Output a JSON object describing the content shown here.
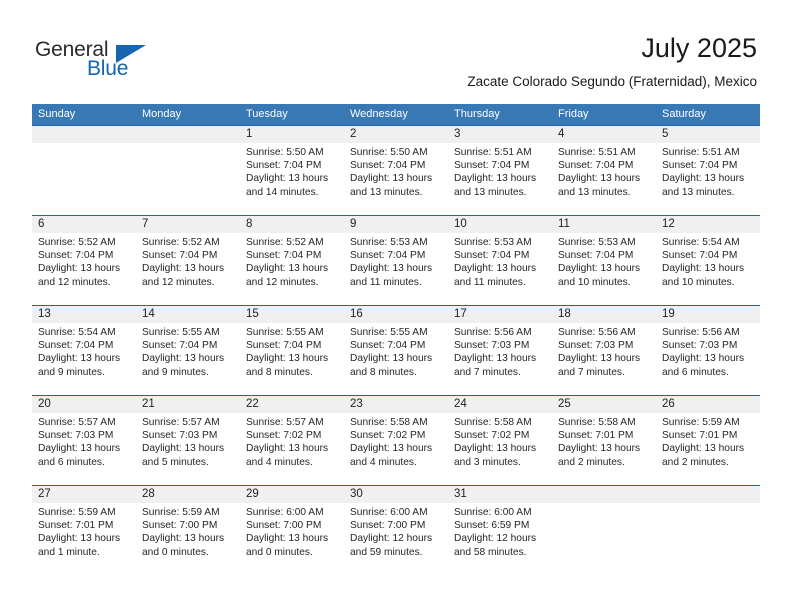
{
  "brand": {
    "name_part1": "General",
    "name_part2": "Blue"
  },
  "header": {
    "month_title": "July 2025",
    "location": "Zacate Colorado Segundo (Fraternidad), Mexico"
  },
  "theme": {
    "header_blue": "#3878b4",
    "row_border_blue": "#1f63a8",
    "day_band_gray": "#f0f0f0",
    "brand_blue": "#1565b0"
  },
  "weekdays": [
    "Sunday",
    "Monday",
    "Tuesday",
    "Wednesday",
    "Thursday",
    "Friday",
    "Saturday"
  ],
  "weeks": [
    [
      {
        "day": "",
        "sunrise": "",
        "sunset": "",
        "daylight": ""
      },
      {
        "day": "",
        "sunrise": "",
        "sunset": "",
        "daylight": ""
      },
      {
        "day": "1",
        "sunrise": "Sunrise: 5:50 AM",
        "sunset": "Sunset: 7:04 PM",
        "daylight": "Daylight: 13 hours and 14 minutes."
      },
      {
        "day": "2",
        "sunrise": "Sunrise: 5:50 AM",
        "sunset": "Sunset: 7:04 PM",
        "daylight": "Daylight: 13 hours and 13 minutes."
      },
      {
        "day": "3",
        "sunrise": "Sunrise: 5:51 AM",
        "sunset": "Sunset: 7:04 PM",
        "daylight": "Daylight: 13 hours and 13 minutes."
      },
      {
        "day": "4",
        "sunrise": "Sunrise: 5:51 AM",
        "sunset": "Sunset: 7:04 PM",
        "daylight": "Daylight: 13 hours and 13 minutes."
      },
      {
        "day": "5",
        "sunrise": "Sunrise: 5:51 AM",
        "sunset": "Sunset: 7:04 PM",
        "daylight": "Daylight: 13 hours and 13 minutes."
      }
    ],
    [
      {
        "day": "6",
        "sunrise": "Sunrise: 5:52 AM",
        "sunset": "Sunset: 7:04 PM",
        "daylight": "Daylight: 13 hours and 12 minutes."
      },
      {
        "day": "7",
        "sunrise": "Sunrise: 5:52 AM",
        "sunset": "Sunset: 7:04 PM",
        "daylight": "Daylight: 13 hours and 12 minutes."
      },
      {
        "day": "8",
        "sunrise": "Sunrise: 5:52 AM",
        "sunset": "Sunset: 7:04 PM",
        "daylight": "Daylight: 13 hours and 12 minutes."
      },
      {
        "day": "9",
        "sunrise": "Sunrise: 5:53 AM",
        "sunset": "Sunset: 7:04 PM",
        "daylight": "Daylight: 13 hours and 11 minutes."
      },
      {
        "day": "10",
        "sunrise": "Sunrise: 5:53 AM",
        "sunset": "Sunset: 7:04 PM",
        "daylight": "Daylight: 13 hours and 11 minutes."
      },
      {
        "day": "11",
        "sunrise": "Sunrise: 5:53 AM",
        "sunset": "Sunset: 7:04 PM",
        "daylight": "Daylight: 13 hours and 10 minutes."
      },
      {
        "day": "12",
        "sunrise": "Sunrise: 5:54 AM",
        "sunset": "Sunset: 7:04 PM",
        "daylight": "Daylight: 13 hours and 10 minutes."
      }
    ],
    [
      {
        "day": "13",
        "sunrise": "Sunrise: 5:54 AM",
        "sunset": "Sunset: 7:04 PM",
        "daylight": "Daylight: 13 hours and 9 minutes."
      },
      {
        "day": "14",
        "sunrise": "Sunrise: 5:55 AM",
        "sunset": "Sunset: 7:04 PM",
        "daylight": "Daylight: 13 hours and 9 minutes."
      },
      {
        "day": "15",
        "sunrise": "Sunrise: 5:55 AM",
        "sunset": "Sunset: 7:04 PM",
        "daylight": "Daylight: 13 hours and 8 minutes."
      },
      {
        "day": "16",
        "sunrise": "Sunrise: 5:55 AM",
        "sunset": "Sunset: 7:04 PM",
        "daylight": "Daylight: 13 hours and 8 minutes."
      },
      {
        "day": "17",
        "sunrise": "Sunrise: 5:56 AM",
        "sunset": "Sunset: 7:03 PM",
        "daylight": "Daylight: 13 hours and 7 minutes."
      },
      {
        "day": "18",
        "sunrise": "Sunrise: 5:56 AM",
        "sunset": "Sunset: 7:03 PM",
        "daylight": "Daylight: 13 hours and 7 minutes."
      },
      {
        "day": "19",
        "sunrise": "Sunrise: 5:56 AM",
        "sunset": "Sunset: 7:03 PM",
        "daylight": "Daylight: 13 hours and 6 minutes."
      }
    ],
    [
      {
        "day": "20",
        "sunrise": "Sunrise: 5:57 AM",
        "sunset": "Sunset: 7:03 PM",
        "daylight": "Daylight: 13 hours and 6 minutes."
      },
      {
        "day": "21",
        "sunrise": "Sunrise: 5:57 AM",
        "sunset": "Sunset: 7:03 PM",
        "daylight": "Daylight: 13 hours and 5 minutes."
      },
      {
        "day": "22",
        "sunrise": "Sunrise: 5:57 AM",
        "sunset": "Sunset: 7:02 PM",
        "daylight": "Daylight: 13 hours and 4 minutes."
      },
      {
        "day": "23",
        "sunrise": "Sunrise: 5:58 AM",
        "sunset": "Sunset: 7:02 PM",
        "daylight": "Daylight: 13 hours and 4 minutes."
      },
      {
        "day": "24",
        "sunrise": "Sunrise: 5:58 AM",
        "sunset": "Sunset: 7:02 PM",
        "daylight": "Daylight: 13 hours and 3 minutes."
      },
      {
        "day": "25",
        "sunrise": "Sunrise: 5:58 AM",
        "sunset": "Sunset: 7:01 PM",
        "daylight": "Daylight: 13 hours and 2 minutes."
      },
      {
        "day": "26",
        "sunrise": "Sunrise: 5:59 AM",
        "sunset": "Sunset: 7:01 PM",
        "daylight": "Daylight: 13 hours and 2 minutes."
      }
    ],
    [
      {
        "day": "27",
        "sunrise": "Sunrise: 5:59 AM",
        "sunset": "Sunset: 7:01 PM",
        "daylight": "Daylight: 13 hours and 1 minute."
      },
      {
        "day": "28",
        "sunrise": "Sunrise: 5:59 AM",
        "sunset": "Sunset: 7:00 PM",
        "daylight": "Daylight: 13 hours and 0 minutes."
      },
      {
        "day": "29",
        "sunrise": "Sunrise: 6:00 AM",
        "sunset": "Sunset: 7:00 PM",
        "daylight": "Daylight: 13 hours and 0 minutes."
      },
      {
        "day": "30",
        "sunrise": "Sunrise: 6:00 AM",
        "sunset": "Sunset: 7:00 PM",
        "daylight": "Daylight: 12 hours and 59 minutes."
      },
      {
        "day": "31",
        "sunrise": "Sunrise: 6:00 AM",
        "sunset": "Sunset: 6:59 PM",
        "daylight": "Daylight: 12 hours and 58 minutes."
      },
      {
        "day": "",
        "sunrise": "",
        "sunset": "",
        "daylight": ""
      },
      {
        "day": "",
        "sunrise": "",
        "sunset": "",
        "daylight": ""
      }
    ]
  ]
}
